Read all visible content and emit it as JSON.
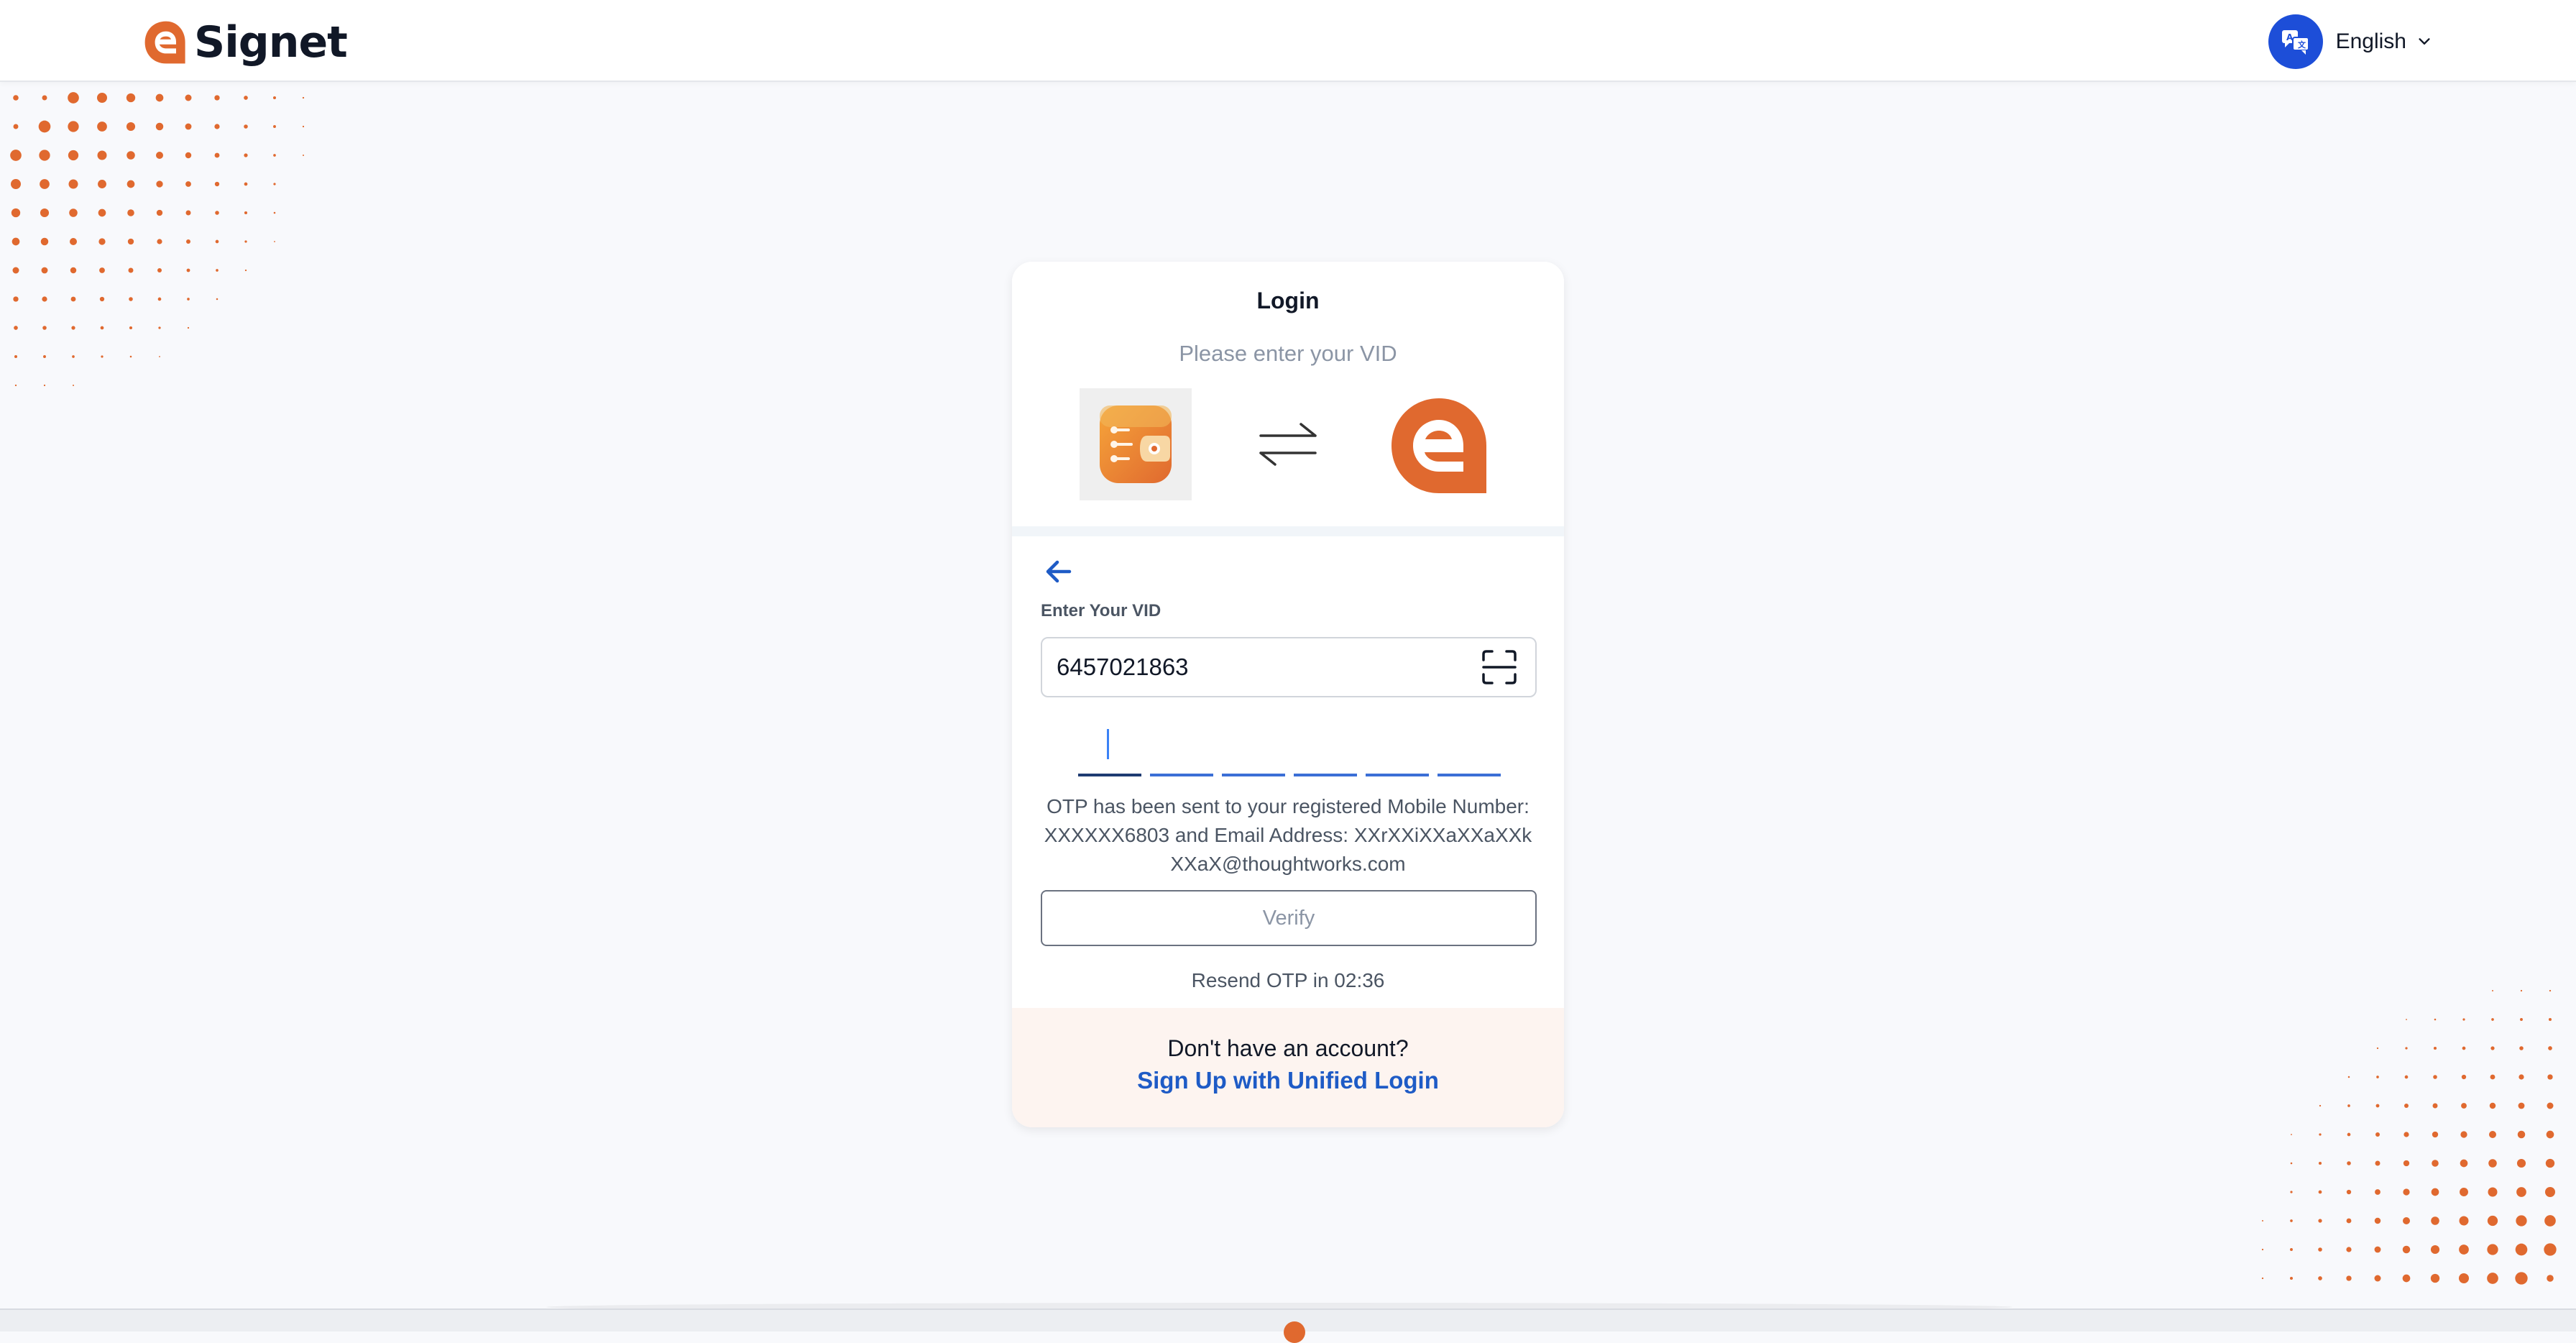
{
  "header": {
    "brand_name": "Signet",
    "language_label": "English",
    "icons": {
      "brand": "esignet-logo-icon",
      "language": "translate-icon",
      "chevron": "chevron-down-icon"
    }
  },
  "login": {
    "title": "Login",
    "subtitle": "Please enter your VID",
    "field_label": "Enter Your VID",
    "vid_value": "6457021863",
    "otp_message": "OTP has been sent to your registered Mobile Number: XXXXXX6803 and Email Address: XXrXXiXXaXXaXXkXXaX@thoughtworks.com",
    "verify_label": "Verify",
    "resend_text": "Resend OTP in 02:36"
  },
  "footer": {
    "no_account_text": "Don't have an account?",
    "signup_label": "Sign Up with Unified Login"
  },
  "colors": {
    "accent": "#e0692f",
    "link": "#1e5bc6",
    "otp_underline": "#3b6fd6",
    "footer_bg": "#fdf4f0",
    "language_icon_bg": "#1d4ed8"
  }
}
